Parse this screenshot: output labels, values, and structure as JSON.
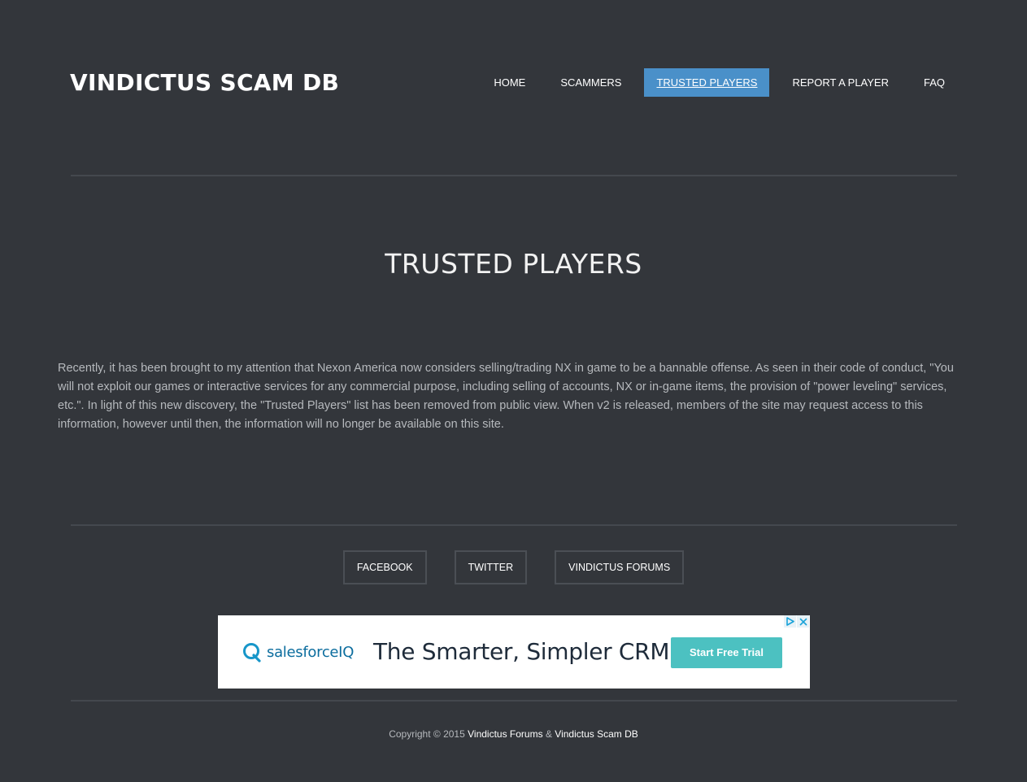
{
  "header": {
    "site_title": "VINDICTUS SCAM DB",
    "nav": [
      {
        "label": "HOME",
        "active": false
      },
      {
        "label": "SCAMMERS",
        "active": false
      },
      {
        "label": "TRUSTED PLAYERS",
        "active": true
      },
      {
        "label": "REPORT A PLAYER",
        "active": false
      },
      {
        "label": "FAQ",
        "active": false
      }
    ]
  },
  "main": {
    "heading": "TRUSTED PLAYERS",
    "notice": "Recently, it has been brought to my attention that Nexon America now considers selling/trading NX in game to be a bannable offense. As seen in their code of conduct, \"You will not exploit our games or interactive services for any commercial purpose, including selling of accounts, NX or in-game items, the provision of \"power leveling\" services, etc.\". In light of this new discovery, the \"Trusted Players\" list has been removed from public view. When v2 is released, members of the site may request access to this information, however until then, the information will no longer be available on this site."
  },
  "footer": {
    "social": [
      {
        "label": "FACEBOOK"
      },
      {
        "label": "TWITTER"
      },
      {
        "label": "VINDICTUS FORUMS"
      }
    ],
    "ad": {
      "brand": "salesforceIQ",
      "headline": "The Smarter, Simpler CRM",
      "cta": "Start Free Trial",
      "icons": [
        "adchoices-icon",
        "close-icon"
      ]
    },
    "copyright": {
      "prefix": "Copyright © 2015",
      "link1": "Vindictus Forums",
      "separator": "&",
      "link2": "Vindictus Scam DB"
    }
  },
  "colors": {
    "background": "#33363b",
    "accent": "#4a90c9",
    "rule": "#44484e",
    "body_text": "#b6b9bd",
    "ad_cta": "#4cc1c1",
    "ad_brand": "#0c6d9e"
  }
}
